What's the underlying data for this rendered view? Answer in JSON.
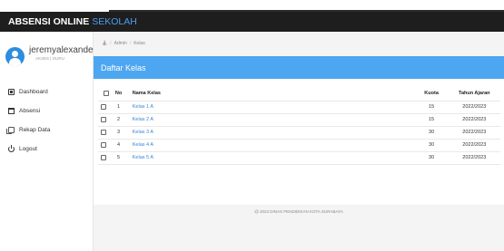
{
  "app": {
    "title_main": "ABSENSI ONLINE",
    "title_accent": "SEKOLAH",
    "accent_color": "#4d9ef0"
  },
  "user": {
    "name": "jeremyalexander",
    "role": "AKSES | GURU",
    "avatar_icon": "user-icon"
  },
  "sidebar": {
    "items": [
      {
        "label": "Dashboard",
        "icon": "dashboard-icon"
      },
      {
        "label": "Absensi",
        "icon": "calendar-icon"
      },
      {
        "label": "Rekap Data",
        "icon": "copy-icon"
      },
      {
        "label": "Logout",
        "icon": "power-icon"
      }
    ]
  },
  "breadcrumb": {
    "items": [
      "Admin",
      "Kelas"
    ],
    "home_icon": "home-icon"
  },
  "card": {
    "title": "Daftar Kelas",
    "header_color": "#4da6f0"
  },
  "table": {
    "headers": [
      "No",
      "Nama Kelas",
      "Kuota",
      "Tahun Ajaran"
    ],
    "rows": [
      {
        "no": "1",
        "nama": "Kelas 1 A",
        "kuota": "15",
        "tahun": "2022/2023"
      },
      {
        "no": "2",
        "nama": "Kelas 2 A",
        "kuota": "15",
        "tahun": "2022/2023"
      },
      {
        "no": "3",
        "nama": "Kelas 3 A",
        "kuota": "30",
        "tahun": "2022/2023"
      },
      {
        "no": "4",
        "nama": "Kelas 4 A",
        "kuota": "30",
        "tahun": "2022/2023"
      },
      {
        "no": "5",
        "nama": "Kelas 5 A",
        "kuota": "30",
        "tahun": "2022/2023"
      }
    ]
  },
  "footer": {
    "text": "@ 2023 DINAS PENDIDIKAN KOTA SURABAYA"
  }
}
